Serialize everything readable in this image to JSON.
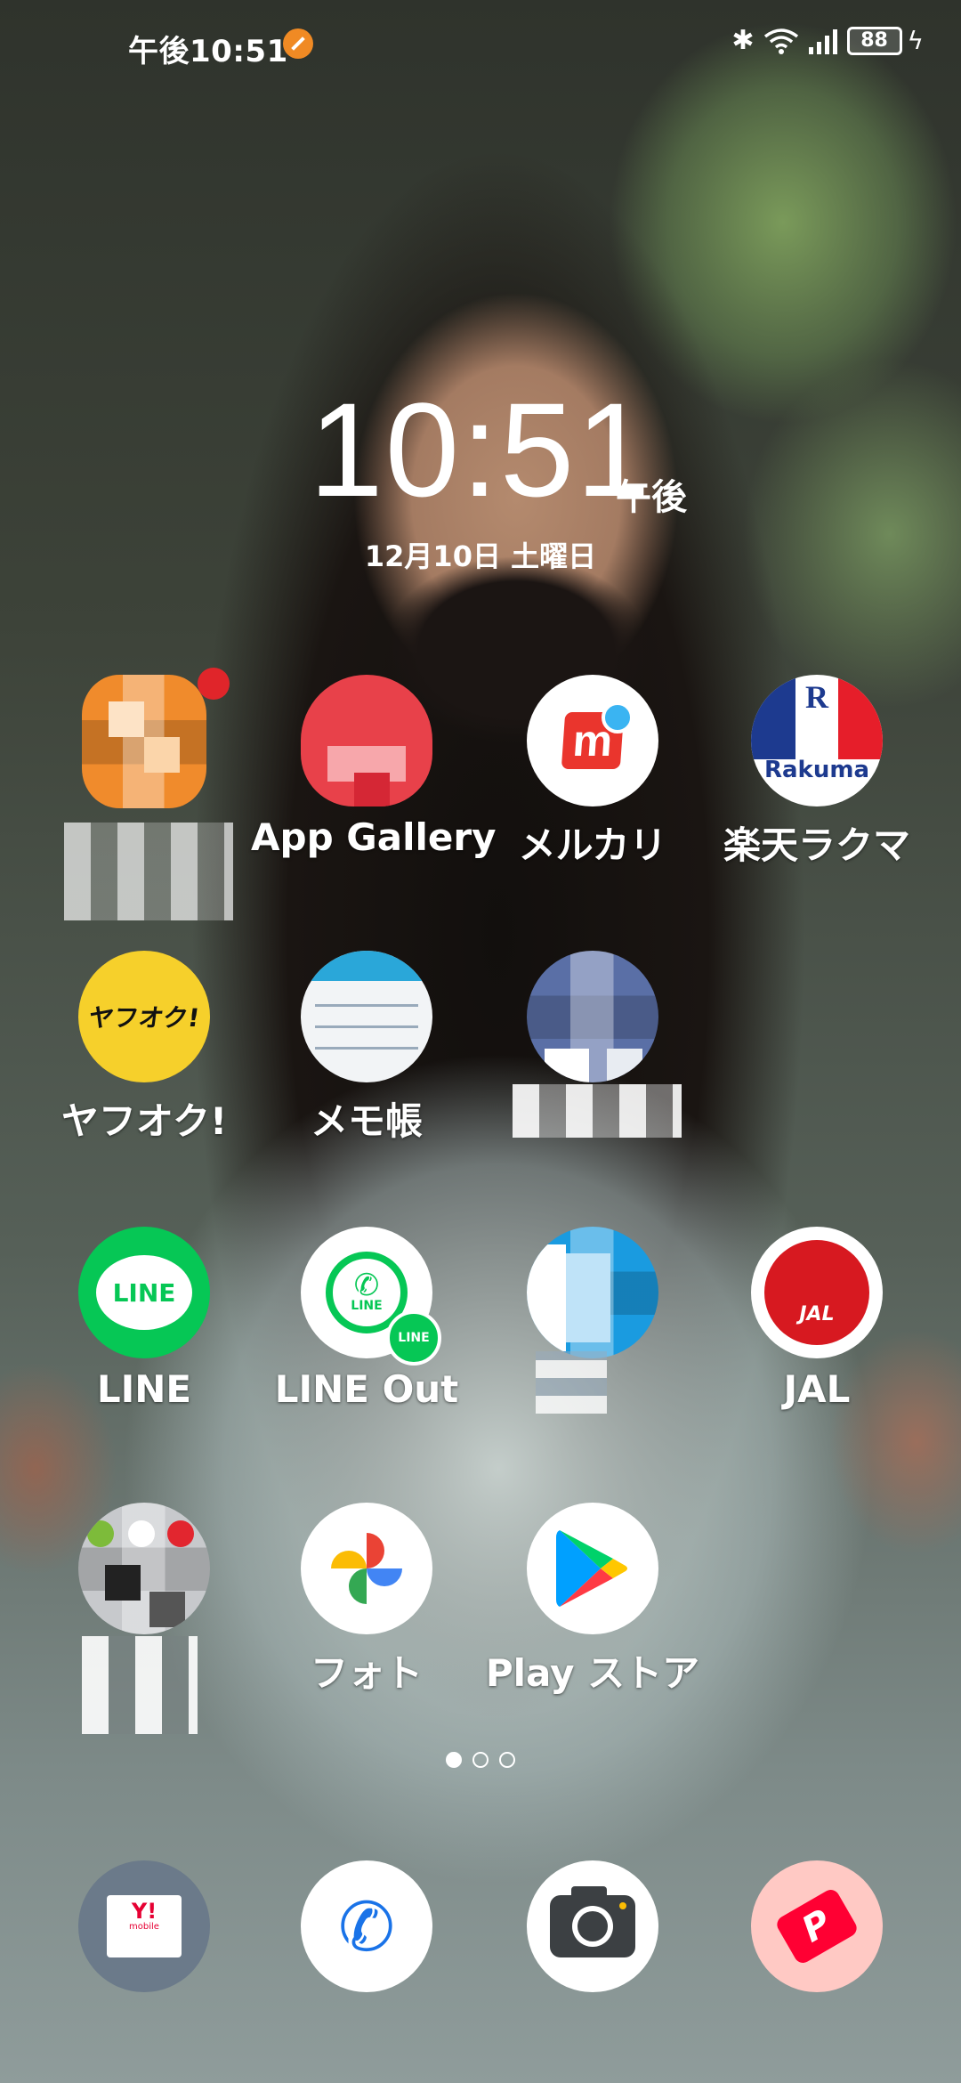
{
  "status_bar": {
    "time": "午後10:51",
    "battery": "88",
    "icons": [
      "notification-app-icon",
      "bluetooth-icon",
      "wifi-icon",
      "signal-icon",
      "battery-icon",
      "charging-icon"
    ]
  },
  "clock": {
    "time": "10:51",
    "ampm": "午後",
    "date": "12月10日 土曜日"
  },
  "apps": [
    {
      "label": "",
      "icon": "pixelated-orange-app-icon"
    },
    {
      "label": "App Gallery",
      "icon": "app-gallery-icon"
    },
    {
      "label": "メルカリ",
      "icon": "mercari-icon"
    },
    {
      "label": "楽天ラクマ",
      "icon": "rakuma-icon",
      "icon_text": "Rakuma",
      "icon_letter": "R"
    },
    {
      "label": "ヤフオク!",
      "icon": "yafuoku-icon",
      "icon_text": "ヤフオク!"
    },
    {
      "label": "メモ帳",
      "icon": "memo-icon"
    },
    {
      "label": "",
      "icon": "pixelated-blue-app-icon"
    },
    {
      "label": "LINE",
      "icon": "line-icon",
      "icon_text": "LINE"
    },
    {
      "label": "LINE Out",
      "icon": "line-out-icon",
      "icon_text": "LINE",
      "badge_text": "LINE"
    },
    {
      "label": "",
      "icon": "pixelated-pay-app-icon"
    },
    {
      "label": "JAL",
      "icon": "jal-icon",
      "icon_text": "JAL"
    },
    {
      "label": "",
      "icon": "pixelated-folder-icon"
    },
    {
      "label": "フォト",
      "icon": "google-photos-icon"
    },
    {
      "label": "Play ストア",
      "icon": "play-store-icon"
    }
  ],
  "page_indicator": {
    "count": 3,
    "active": 0
  },
  "dock": [
    {
      "icon": "ymobile-mail-icon",
      "icon_text": "Y!",
      "icon_subtext": "mobile"
    },
    {
      "icon": "phone-icon"
    },
    {
      "icon": "camera-icon"
    },
    {
      "icon": "paypay-icon"
    }
  ],
  "colors": {
    "mercari": "#ea352d",
    "rakuma_blue": "#1d3a8f",
    "rakuma_red": "#e61e2a",
    "yafuoku": "#f6d02b",
    "line": "#06c755",
    "jal": "#d71920",
    "paypay": "#ff0033"
  }
}
